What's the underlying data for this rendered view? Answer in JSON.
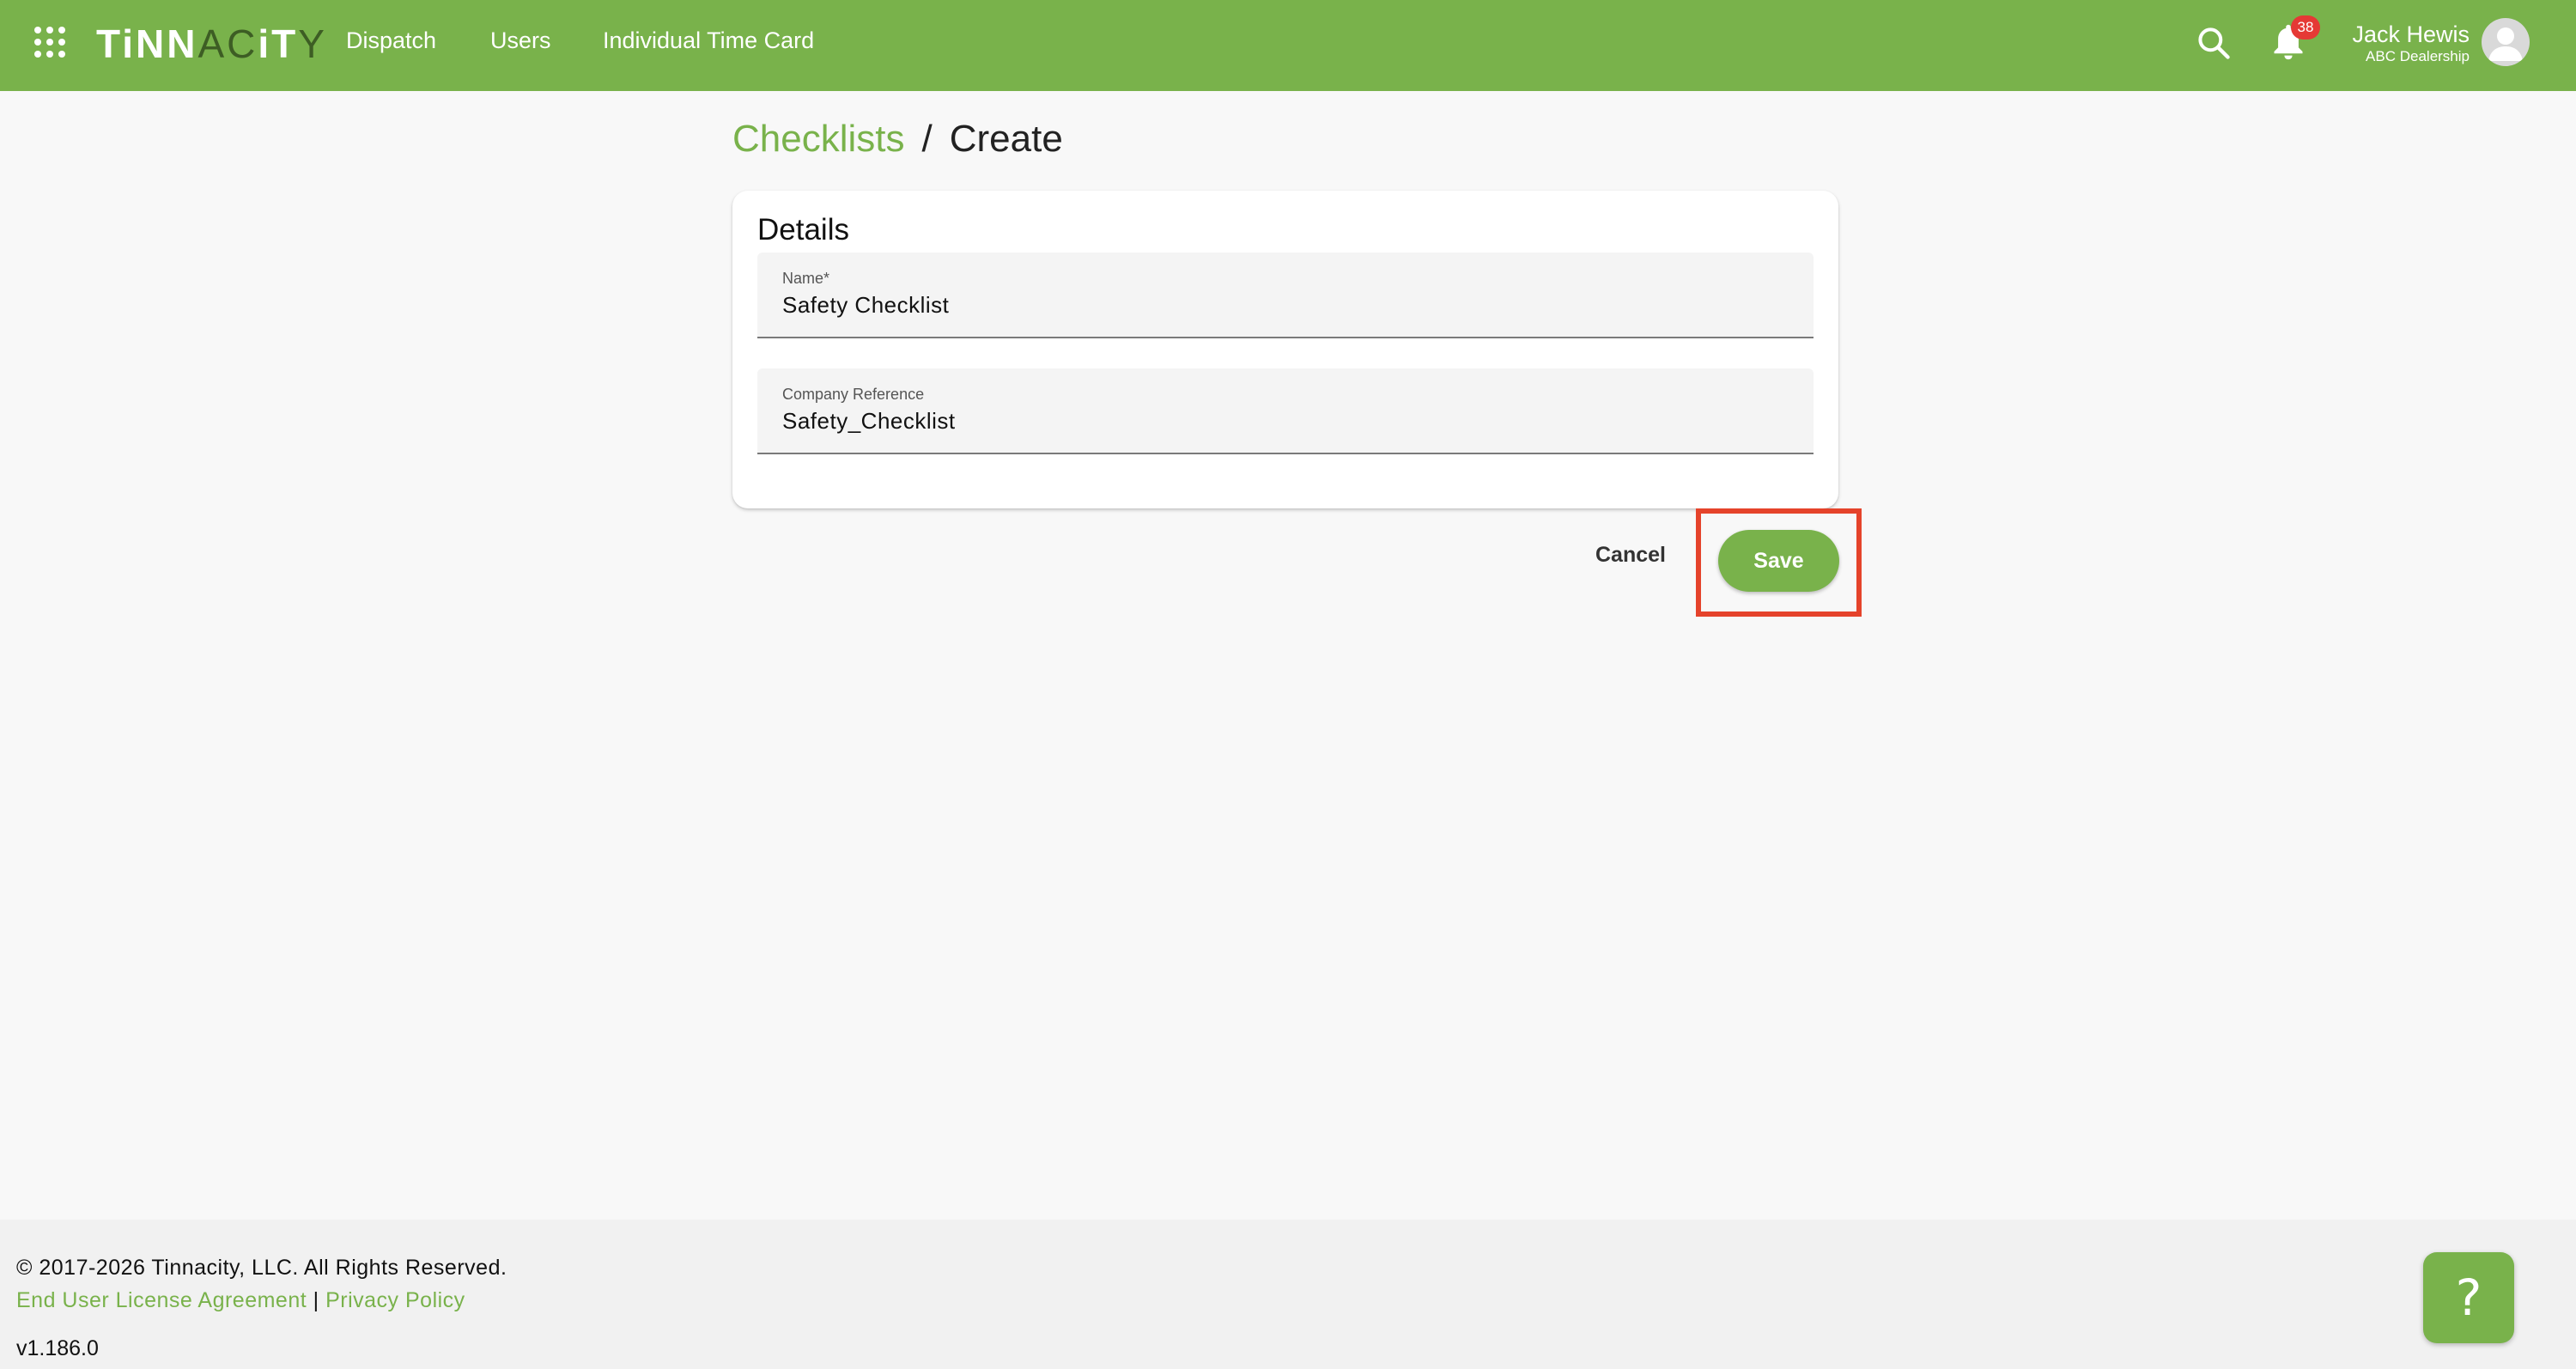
{
  "header": {
    "logo_text_bold": "TiNN",
    "logo_text_thin": "AC",
    "logo_text_bold2": "iT",
    "logo_text_end": "Y",
    "nav": {
      "dispatch": "Dispatch",
      "users": "Users",
      "time_card": "Individual Time Card"
    },
    "notification_count": "38",
    "user_name": "Jack Hewis",
    "user_company": "ABC Dealership"
  },
  "breadcrumb": {
    "parent": "Checklists",
    "separator": "/",
    "current": "Create"
  },
  "details": {
    "title": "Details",
    "name_label": "Name*",
    "name_value": "Safety Checklist",
    "ref_label": "Company Reference",
    "ref_value": "Safety_Checklist"
  },
  "actions": {
    "cancel": "Cancel",
    "save": "Save"
  },
  "footer": {
    "copyright": "© 2017-2026 Tinnacity, LLC. All Rights Reserved.",
    "eula": "End User License Agreement",
    "divider": "|",
    "privacy": "Privacy Policy",
    "version": "v1.186.0",
    "help_glyph": "?"
  },
  "colors": {
    "brand_green": "#79b24b",
    "highlight_red": "#e5432b",
    "badge_red": "#e53935"
  },
  "icons": [
    "apps-grid-icon",
    "search-icon",
    "bell-icon",
    "avatar-icon",
    "help-icon"
  ]
}
